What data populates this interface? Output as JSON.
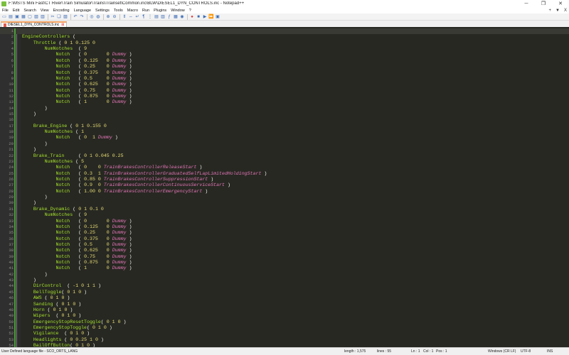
{
  "window": {
    "title": "F:\\MSTS Mini Fast\\CT River\\Train Simulator\\Trains\\Trainset\\Common.inc\\BLW\\DIESEL1_DYN_CONTROLS.inc - Notepad++"
  },
  "menu": [
    "File",
    "Edit",
    "Search",
    "View",
    "Encoding",
    "Language",
    "Settings",
    "Tools",
    "Macro",
    "Run",
    "Plugins",
    "Window",
    "?"
  ],
  "menu_right": [
    "+",
    "▼",
    "X"
  ],
  "tab": {
    "label": "DIESEL1_DYN_CONTROLS.inc"
  },
  "editor": {
    "lines": [
      "",
      "EngineControllers (",
      "    Throttle ( 0 1 0.125 0",
      "        NumNotches  ( 9",
      "            Notch   ( 0       0 Dummy )",
      "            Notch   ( 0.125   0 Dummy )",
      "            Notch   ( 0.25    0 Dummy )",
      "            Notch   ( 0.375   0 Dummy )",
      "            Notch   ( 0.5     0 Dummy )",
      "            Notch   ( 0.625   0 Dummy )",
      "            Notch   ( 0.75    0 Dummy )",
      "            Notch   ( 0.875   0 Dummy )",
      "            Notch   ( 1       0 Dummy )",
      "        )",
      "    )",
      "",
      "    Brake_Engine ( 0 1 0.155 0",
      "        NumNotches ( 1",
      "            Notch   ( 0  1 Dummy )",
      "        )",
      "    )",
      "    Brake_Train     ( 0 1 0.045 0.25",
      "        NumNotches ( 5",
      "            Notch   ( 0    0 TrainBrakesControllerReleaseStart )",
      "            Notch   ( 0.3  1 TrainBrakesControllerGraduatedSelfLapLimitedHoldingStart )",
      "            Notch   ( 0.85 0 TrainBrakesControllerSuppressionStart )",
      "            Notch   ( 0.9  0 TrainBrakesControllerContinuousServiceStart )",
      "            Notch   ( 1.00 0 TrainBrakesControllerEmergencyStart )",
      "        )",
      "    )",
      "    Brake_Dynamic ( 0 1 0.1 0",
      "        NumNotches  ( 9",
      "            Notch   ( 0       0 Dummy )",
      "            Notch   ( 0.125   0 Dummy )",
      "            Notch   ( 0.25    0 Dummy )",
      "            Notch   ( 0.375   0 Dummy )",
      "            Notch   ( 0.5     0 Dummy )",
      "            Notch   ( 0.625   0 Dummy )",
      "            Notch   ( 0.75    0 Dummy )",
      "            Notch   ( 0.875   0 Dummy )",
      "            Notch   ( 1       0 Dummy )",
      "        )",
      "    )",
      "    DirControl  ( -1 0 1 1 )",
      "    BellToggle( 0 1 0 )",
      "    AWS ( 0 1 0 )",
      "    Sanding ( 0 1 0 )",
      "    Horn ( 0 1 0 )",
      "    Wipers  ( 0 1 0 )",
      "    EmergencyStopResetToggle( 0 1 0 )",
      "    EmergencyStopToggle( 0 1 0 )",
      "    Vigilance  ( 0 1 0 )",
      "    Headlights ( 0 0.25 1 0 )",
      "    BailOffButton( 0 1 0 )",
      ")"
    ]
  },
  "statusbar": {
    "lang": "User Defined language file - SCO_ORTS_LANG",
    "length": "length : 1,575",
    "lines": "lines : 55",
    "ln": "Ln : 1",
    "col": "Col : 1",
    "pos": "Pos : 1",
    "eol": "Windows (CR LF)",
    "encoding": "UTF-8",
    "ins": "INS"
  },
  "colors": {
    "editor_bg": "#272822",
    "keyword": "#a6e22e",
    "number": "#e6db74",
    "dummy": "#e276b6"
  }
}
